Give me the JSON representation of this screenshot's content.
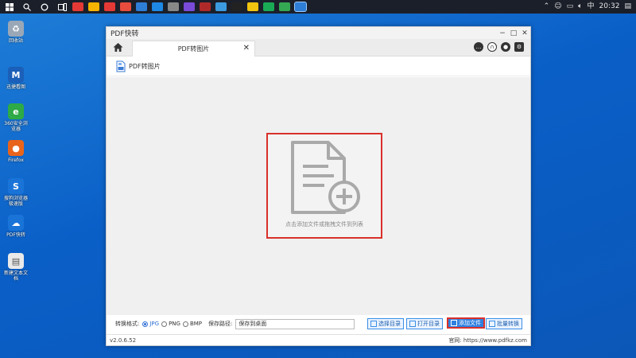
{
  "taskbar": {
    "tray_lang": "中",
    "time": "20:32",
    "apps": [
      "#e53935",
      "#f4b400",
      "#e53935",
      "#e74c3c",
      "#2e7dd7",
      "#1e88e5",
      "#888888",
      "#7a4bd8",
      "#b12a2a",
      "#3c9be0",
      "#222222",
      "#f1c40f",
      "#1aaa55",
      "#34a853",
      "#2e7dd7"
    ]
  },
  "desktop": {
    "icons": [
      {
        "label": "回收站",
        "color": "#9aa7b7",
        "glyph": "♻"
      },
      {
        "label": "迅捷看图",
        "color": "#1b5fb8",
        "glyph": "M"
      },
      {
        "label": "360安全浏览器",
        "color": "#2eaa46",
        "glyph": "e"
      },
      {
        "label": "Firefox",
        "color": "#e8641b",
        "glyph": "●"
      },
      {
        "label": "搜狗浏览器极速版",
        "color": "#1a74d8",
        "glyph": "S"
      },
      {
        "label": "PDF快转",
        "color": "#1a74d8",
        "glyph": "☁"
      },
      {
        "label": "新建文本文档",
        "color": "#e9e9e9",
        "glyph": "▤"
      }
    ]
  },
  "window": {
    "title": "PDF快转",
    "tab_label": "PDF转图片",
    "tab_close": "✕",
    "section_title": "PDF转图片",
    "drop_hint": "点击添加文件或拖拽文件到列表",
    "format_label": "转换格式:",
    "formats": [
      {
        "label": "JPG",
        "selected": true
      },
      {
        "label": "PNG",
        "selected": false
      },
      {
        "label": "BMP",
        "selected": false
      }
    ],
    "save_label": "保存路径:",
    "save_value": "保存到桌面",
    "buttons": {
      "choose_dir": "选择目录",
      "open_dir": "打开目录",
      "add_file": "添加文件",
      "batch_convert": "批量转换"
    },
    "version": "v2.0.6.52",
    "website": "官网: https://www.pdfkz.com"
  }
}
